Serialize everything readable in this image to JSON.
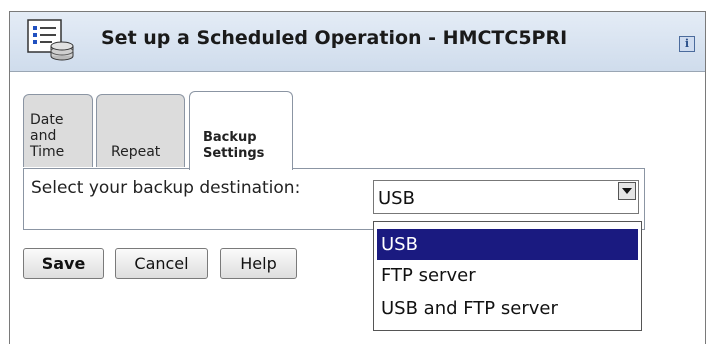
{
  "window": {
    "title": "Set up a Scheduled Operation - HMCTC5PRI",
    "info_label": "i"
  },
  "tabs": [
    {
      "label": "Date\nand\nTime",
      "active": false
    },
    {
      "label": "Repeat",
      "active": false
    },
    {
      "label": "Backup\nSettings",
      "active": true
    }
  ],
  "backup": {
    "destination_label": "Select your backup destination:",
    "selected_value": "USB",
    "options": [
      "USB",
      "FTP server",
      "USB and FTP server"
    ]
  },
  "buttons": {
    "save": "Save",
    "cancel": "Cancel",
    "help": "Help"
  },
  "colors": {
    "selection": "#1a1a80",
    "title_bar": "#d8e3f0"
  }
}
